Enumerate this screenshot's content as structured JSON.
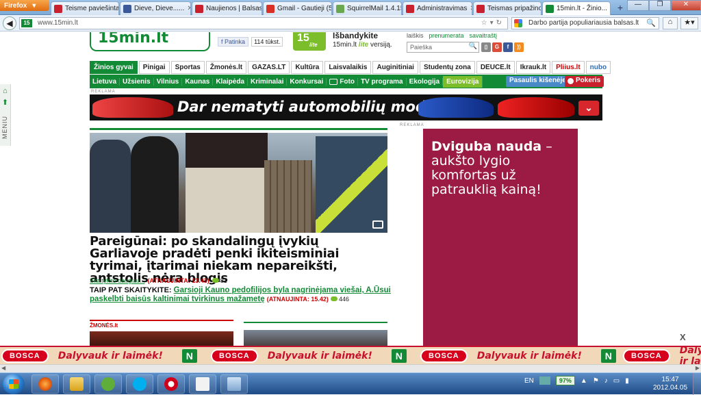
{
  "browser": {
    "app_label": "Firefox",
    "tabs": [
      {
        "label": "Teisme paviešinta ...",
        "fav": "#c9202d"
      },
      {
        "label": "Dieve, Dieve......",
        "fav": "#3b5998"
      },
      {
        "label": "Naujienos | Balsas.lt",
        "fav": "#c9202d"
      },
      {
        "label": "Gmail - Gautieji (5,...",
        "fav": "#d93025"
      },
      {
        "label": "SquirrelMail 1.4.15 ...",
        "fav": "#6aa84f"
      },
      {
        "label": "Administravimas",
        "fav": "#c9202d"
      },
      {
        "label": "Teismas pripažino ...",
        "fav": "#c9202d"
      },
      {
        "label": "15min.lt - Žinio...",
        "fav": "#138a36"
      }
    ],
    "new_tab": "+",
    "url": "www.15min.lt",
    "site_badge": "15",
    "search_value": "Darbo partija populiariausia balsas.lt"
  },
  "site": {
    "logo_text": "15min.lt",
    "fb_like": "Patinka",
    "fb_count": "114 tūkst.",
    "lite_badge": "15",
    "lite_tag": "lite",
    "lite_head": "Išbandykite",
    "lite_sub_pre": "15min.lt",
    "lite_sub_mid": "lite",
    "lite_sub_post": "versiją.",
    "top_links": [
      "laiškis",
      "prenumerata",
      "savaitraštį"
    ],
    "search_placeholder": "Paieška",
    "nav1": [
      {
        "label": "Žinios gyvai",
        "active": true
      },
      {
        "label": "Pinigai"
      },
      {
        "label": "Sportas"
      },
      {
        "label": "Žmonės.lt"
      },
      {
        "label": "GAZAS.LT"
      },
      {
        "label": "Kultūra"
      },
      {
        "label": "Laisvalaikis"
      },
      {
        "label": "Auginitiniai"
      },
      {
        "label": "Studentų zona"
      },
      {
        "label": "DEUCE.lt"
      },
      {
        "label": "Ikrauk.lt"
      },
      {
        "label": "Pliius.lt"
      },
      {
        "label": "nubo"
      }
    ],
    "nav2": [
      "Lietuva",
      "Užsienis",
      "Vilnius",
      "Kaunas",
      "Klaipėda",
      "Kriminalai",
      "Konkursai",
      "Foto",
      "TV programa",
      "Ekologija",
      "Eurovizija"
    ],
    "pasaulis": "Pasaulis kišenėje",
    "pokeris": "Pokeris",
    "reklama": "REKLAMA",
    "banner_slogan": "Dar nematyti automobilių modeliai!",
    "left_menu": "MENIU"
  },
  "article": {
    "headline": "Pareigūnai: po skandalingų įvykių Garliavoje pradėti penki ikiteisminiai tyrimai, įtarimai niekam nepareikšti, antstolis nėra blogis",
    "read_more": "Skaitykite daugiau...",
    "updated": "(ATNAUJINTA: 13.43)",
    "comments": "81",
    "also_label": "TAIP PAT SKAITYKITE:",
    "also_link": "Garsioji Kauno pedofilijos byla nagrinėjama viešai, A.Ūsui paskelbti baisūs kaltinimai tvirkinus mažametę",
    "also_updated": "(ATNAUJINTA: 15.42)",
    "also_comments": "446",
    "section_logo": "ŽMONĖS.lt"
  },
  "right_ad": {
    "label": "REKLAMA",
    "bold": "Dviguba nauda",
    "rest": "– aukšto lygio komfortas už patrauklią kainą!"
  },
  "bottom_ad": {
    "brand": "BOSCA",
    "slogan": "Dalyvauk ir laimėk!",
    "logo": "N",
    "close": "X"
  },
  "taskbar": {
    "lang": "EN",
    "battery": "97%",
    "time": "15:47",
    "date": "2012.04.05"
  }
}
